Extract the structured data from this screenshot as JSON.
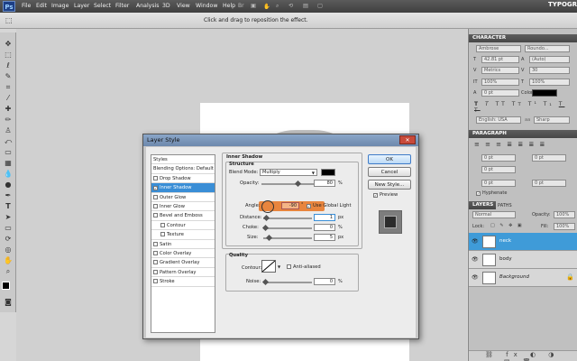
{
  "menubar": {
    "logo": "Ps",
    "items": [
      "File",
      "Edit",
      "Image",
      "Layer",
      "Select",
      "Filter",
      "Analysis",
      "3D",
      "View",
      "Window",
      "Help"
    ],
    "workspace": "TYPOGRAPHY"
  },
  "options": {
    "hint": "Click and drag to reposition the effect."
  },
  "character_panel": {
    "title": "CHARACTER",
    "font": "Ambrose",
    "style": "Roundo...",
    "size": "42.81 pt",
    "leading": "(Auto)",
    "kerning": "Metrics",
    "tracking": "30",
    "vscale": "100%",
    "hscale": "100%",
    "baseline": "0 pt",
    "color_label": "Color:",
    "language": "English: USA",
    "antialias": "Sharp"
  },
  "paragraph_panel": {
    "title": "PARAGRAPH",
    "indent_values": [
      "0 pt",
      "0 pt",
      "0 pt",
      "0 pt",
      "0 pt"
    ],
    "hyphenate": "Hyphenate"
  },
  "layers_panel": {
    "tabs": [
      "LAYERS",
      "PATHS"
    ],
    "blend": "Normal",
    "opacity_label": "Opacity:",
    "opacity": "100%",
    "lock_label": "Lock:",
    "fill_label": "Fill:",
    "fill": "100%",
    "layers": [
      {
        "name": "neck",
        "selected": true
      },
      {
        "name": "body",
        "selected": false
      },
      {
        "name": "Background",
        "selected": false
      }
    ]
  },
  "dialog": {
    "title": "Layer Style",
    "styles": [
      {
        "label": "Styles",
        "checkbox": false,
        "checked": false,
        "selected": false
      },
      {
        "label": "Blending Options: Default",
        "checkbox": false,
        "checked": false,
        "selected": false
      },
      {
        "label": "Drop Shadow",
        "checkbox": true,
        "checked": false,
        "selected": false
      },
      {
        "label": "Inner Shadow",
        "checkbox": true,
        "checked": true,
        "selected": true
      },
      {
        "label": "Outer Glow",
        "checkbox": true,
        "checked": false,
        "selected": false
      },
      {
        "label": "Inner Glow",
        "checkbox": true,
        "checked": false,
        "selected": false
      },
      {
        "label": "Bevel and Emboss",
        "checkbox": true,
        "checked": false,
        "selected": false
      },
      {
        "label": "Contour",
        "checkbox": true,
        "checked": false,
        "selected": false
      },
      {
        "label": "Texture",
        "checkbox": true,
        "checked": false,
        "selected": false
      },
      {
        "label": "Satin",
        "checkbox": true,
        "checked": false,
        "selected": false
      },
      {
        "label": "Color Overlay",
        "checkbox": true,
        "checked": false,
        "selected": false
      },
      {
        "label": "Gradient Overlay",
        "checkbox": true,
        "checked": false,
        "selected": false
      },
      {
        "label": "Pattern Overlay",
        "checkbox": true,
        "checked": false,
        "selected": false
      },
      {
        "label": "Stroke",
        "checkbox": true,
        "checked": false,
        "selected": false
      }
    ],
    "section_title": "Inner Shadow",
    "structure_title": "Structure",
    "blend_mode_label": "Blend Mode:",
    "blend_mode": "Multiply",
    "opacity_label": "Opacity:",
    "opacity": "80",
    "opacity_unit": "%",
    "angle_label": "Angle:",
    "angle": "-90",
    "global_light": "Use Global Light",
    "distance_label": "Distance:",
    "distance": "1",
    "distance_unit": "px",
    "choke_label": "Choke:",
    "choke": "0",
    "choke_unit": "%",
    "size_label": "Size:",
    "size": "5",
    "size_unit": "px",
    "quality_title": "Quality",
    "contour_label": "Contour:",
    "antialiased": "Anti-aliased",
    "noise_label": "Noise:",
    "noise": "0",
    "noise_unit": "%",
    "buttons": {
      "ok": "OK",
      "cancel": "Cancel",
      "new_style": "New Style...",
      "preview": "Preview"
    },
    "shadow_color": "#000000"
  },
  "colors": {
    "accent": "#3a8ed6",
    "highlight": "#e87a2b"
  }
}
